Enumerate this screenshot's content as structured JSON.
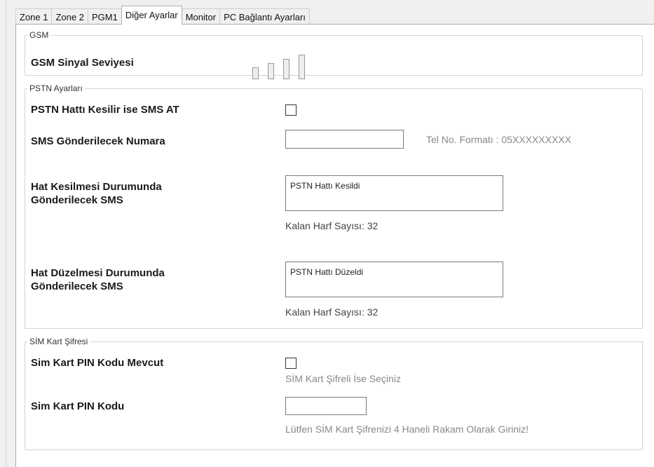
{
  "tabs": [
    {
      "label": "Zone 1",
      "active": false
    },
    {
      "label": "Zone 2",
      "active": false
    },
    {
      "label": "PGM1",
      "active": false
    },
    {
      "label": "Diğer Ayarlar",
      "active": true
    },
    {
      "label": "Monitor",
      "active": false
    },
    {
      "label": "PC Bağlantı Ayarları",
      "active": false
    }
  ],
  "gsm": {
    "legend": "GSM",
    "signal_label": "GSM Sinyal Seviyesi",
    "signal_bars_total": 4,
    "signal_bars_filled": 0
  },
  "pstn": {
    "legend": "PSTN Ayarları",
    "sms_on_cut_label": "PSTN Hattı Kesilir ise SMS AT",
    "sms_on_cut_checked": false,
    "number_label": "SMS Gönderilecek Numara",
    "number_value": "",
    "number_format_hint": "Tel No. Formatı : 05XXXXXXXXX",
    "cut_sms_label_line1": "Hat Kesilmesi Durumunda",
    "cut_sms_label_line2": "Gönderilecek SMS",
    "cut_sms_value": "PSTN Hattı Kesildi",
    "cut_sms_remaining": "Kalan Harf Sayısı: 32",
    "fix_sms_label_line1": "Hat Düzelmesi Durumunda",
    "fix_sms_label_line2": "Gönderilecek SMS",
    "fix_sms_value": "PSTN Hattı Düzeldi",
    "fix_sms_remaining": "Kalan Harf Sayısı: 32"
  },
  "sim": {
    "legend": "SİM Kart Şifresi",
    "pin_exists_label": "Sim Kart PIN Kodu Mevcut",
    "pin_exists_checked": false,
    "pin_exists_hint": "SİM Kart Şifreli İse Seçiniz",
    "pin_label": "Sim Kart PIN Kodu",
    "pin_value": "",
    "pin_hint": "Lütfen SİM Kart Şifrenizi 4 Haneli Rakam Olarak Giriniz!"
  }
}
